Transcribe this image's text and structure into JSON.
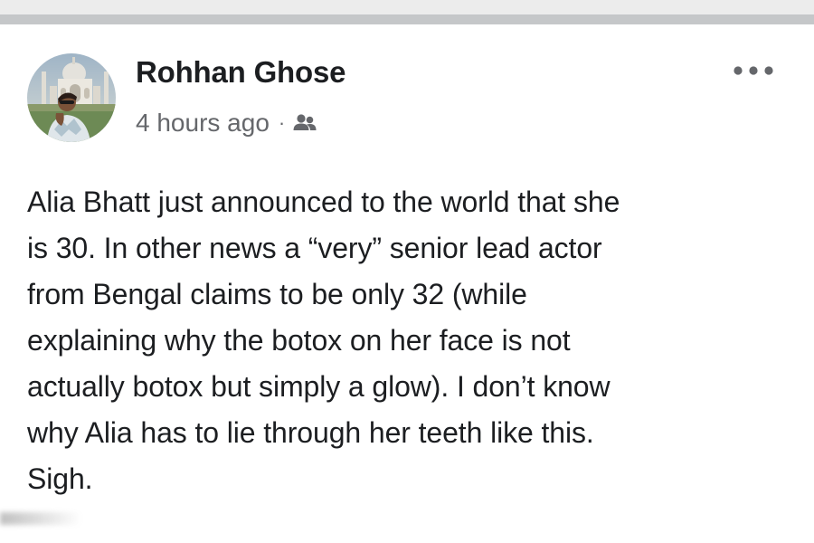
{
  "post": {
    "author": {
      "name": "Rohhan Ghose",
      "avatar_icon": "profile-photo-taj-mahal"
    },
    "meta": {
      "time": "4 hours ago",
      "separator": "·",
      "audience_icon": "friends-icon"
    },
    "menu_icon": "more-options-icon",
    "body_lines": [
      "Alia Bhatt just announced to the world that she",
      "is 30. In other news a “very” senior lead actor",
      "from Bengal claims to be only 32 (while",
      "explaining why the botox on her face is not",
      "actually botox but simply a glow). I don’t know",
      "why Alia has to lie through her teeth like this.",
      "Sigh."
    ]
  },
  "colors": {
    "name_text": "#1c1e21",
    "meta_text": "#65676b",
    "divider": "#c5c7c9",
    "top_band": "#ececec",
    "background": "#ffffff"
  }
}
